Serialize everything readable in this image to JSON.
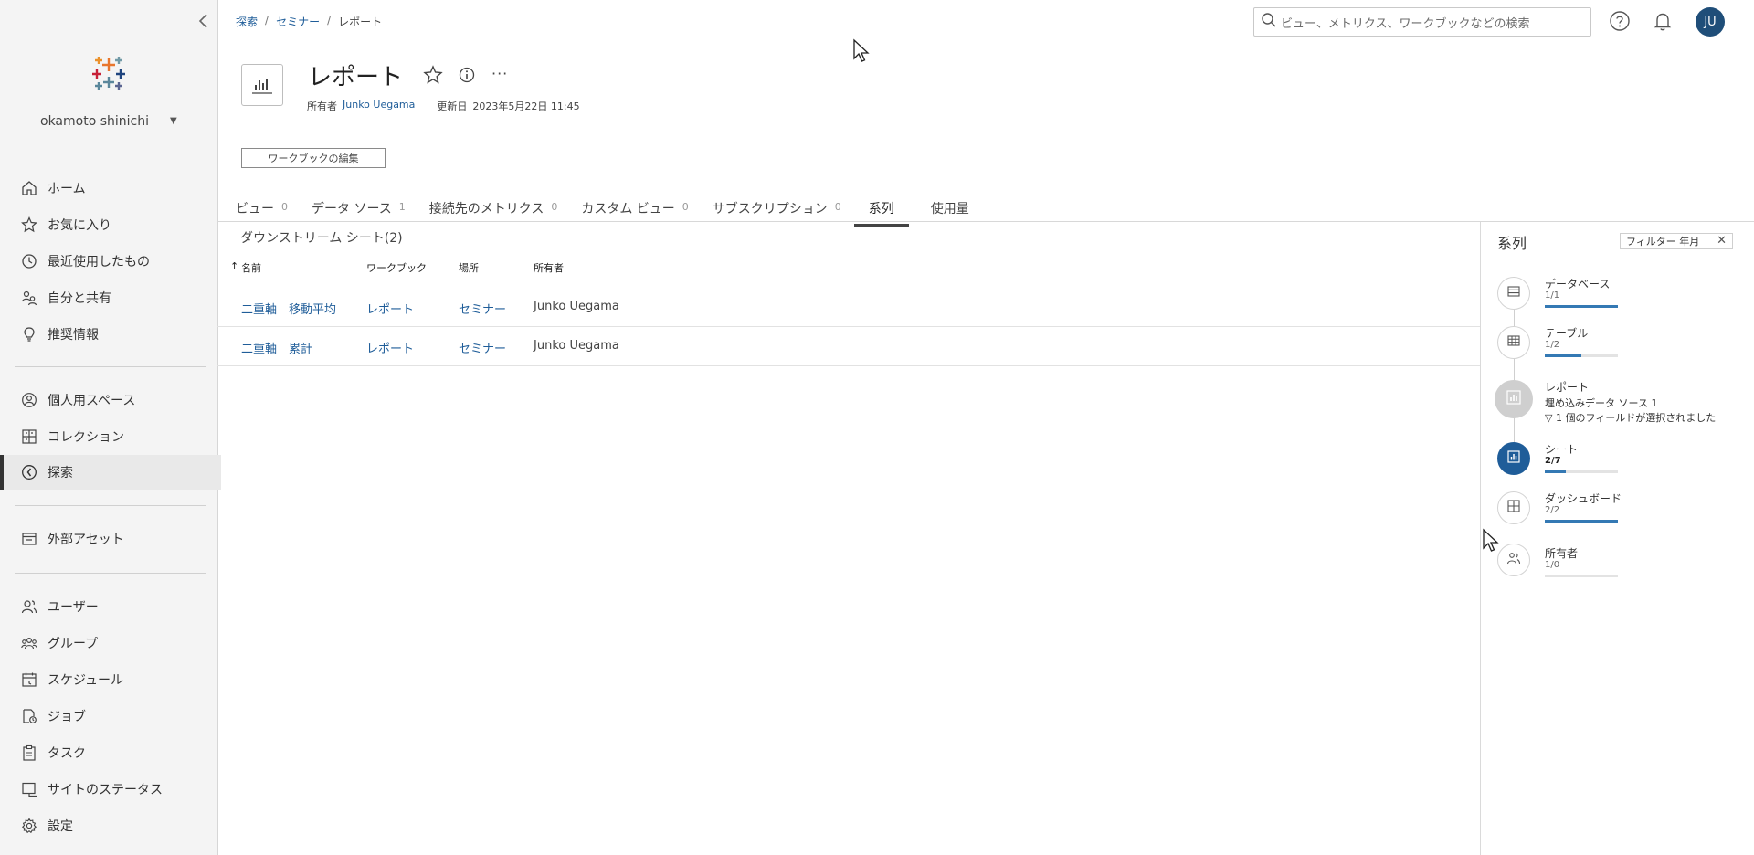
{
  "sidebar": {
    "user_name": "okamoto shinichi",
    "nav_group1": [
      {
        "label": "ホーム",
        "icon": "home-icon"
      },
      {
        "label": "お気に入り",
        "icon": "star-icon"
      },
      {
        "label": "最近使用したもの",
        "icon": "clock-icon"
      },
      {
        "label": "自分と共有",
        "icon": "shared-users-icon"
      },
      {
        "label": "推奨情報",
        "icon": "lightbulb-icon"
      }
    ],
    "nav_group2": [
      {
        "label": "個人用スペース",
        "icon": "person-circle-icon"
      },
      {
        "label": "コレクション",
        "icon": "collection-icon"
      },
      {
        "label": "探索",
        "icon": "compass-icon",
        "active": true
      }
    ],
    "nav_group3": [
      {
        "label": "外部アセット",
        "icon": "external-assets-icon"
      }
    ],
    "nav_group4": [
      {
        "label": "ユーザー",
        "icon": "user-icon"
      },
      {
        "label": "グループ",
        "icon": "group-icon"
      },
      {
        "label": "スケジュール",
        "icon": "calendar-icon"
      },
      {
        "label": "ジョブ",
        "icon": "job-icon"
      },
      {
        "label": "タスク",
        "icon": "task-icon"
      },
      {
        "label": "サイトのステータス",
        "icon": "site-status-icon"
      },
      {
        "label": "設定",
        "icon": "gear-icon"
      }
    ]
  },
  "breadcrumb": {
    "items": [
      "探索",
      "セミナー"
    ],
    "current": "レポート",
    "separator": "/"
  },
  "search": {
    "placeholder": "ビュー、メトリクス、ワークブックなどの検索"
  },
  "user_avatar": "JU",
  "header": {
    "title": "レポート",
    "owner_label": "所有者",
    "owner": "Junko Uegama",
    "updated_label": "更新日",
    "updated": "2023年5月22日 11:45",
    "more": "···",
    "edit_button": "ワークブックの編集"
  },
  "tabs": [
    {
      "label": "ビュー",
      "count": "0"
    },
    {
      "label": "データ ソース",
      "count": "1"
    },
    {
      "label": "接続先のメトリクス",
      "count": "0"
    },
    {
      "label": "カスタム ビュー",
      "count": "0"
    },
    {
      "label": "サブスクリプション",
      "count": "0"
    },
    {
      "label": "系列",
      "count": "",
      "active": true
    },
    {
      "label": "使用量",
      "count": ""
    }
  ],
  "downstream": {
    "title": "ダウンストリーム シート(2)",
    "columns": [
      "名前",
      "ワークブック",
      "場所",
      "所有者"
    ],
    "sort_indicator": "↑",
    "rows": [
      {
        "name": "二重軸　移動平均",
        "workbook": "レポート",
        "location": "セミナー",
        "owner": "Junko Uegama"
      },
      {
        "name": "二重軸　累計",
        "workbook": "レポート",
        "location": "セミナー",
        "owner": "Junko Uegama"
      }
    ]
  },
  "lineage": {
    "title": "系列",
    "filter_label": "フィルター 年月",
    "filter_close": "✕",
    "nodes": [
      {
        "label": "データベース",
        "count": "1/1",
        "fill": 1.0,
        "icon": "database-icon"
      },
      {
        "label": "テーブル",
        "count": "1/2",
        "fill": 0.5,
        "icon": "table-icon"
      },
      {
        "label": "レポート",
        "sub1": "埋め込みデータ ソース 1",
        "sub2": "▽ 1 個のフィールドが選択されました",
        "icon": "workbook-icon"
      },
      {
        "label": "シート",
        "count": "2/7",
        "fill": 0.2857,
        "icon": "sheet-icon"
      },
      {
        "label": "ダッシュボード",
        "count": "2/2",
        "fill": 1.0,
        "icon": "dashboard-icon"
      },
      {
        "label": "所有者",
        "count": "1/0",
        "fill": 0.0,
        "icon": "owner-icon"
      }
    ]
  },
  "colors": {
    "accent": "#1f5d99",
    "active_node": "#1f5d99",
    "bar": "#3479b4"
  }
}
